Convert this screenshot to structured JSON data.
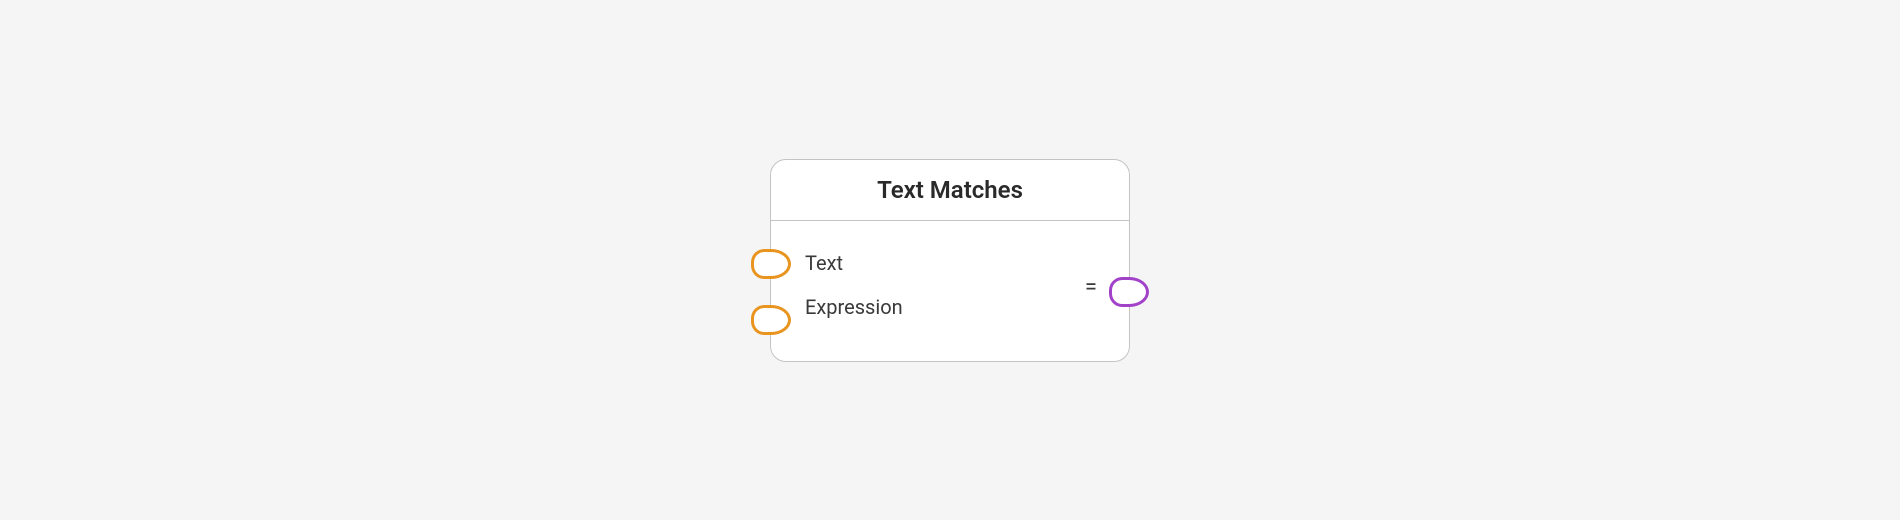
{
  "node": {
    "title": "Text Matches",
    "inputs": [
      {
        "label": "Text",
        "color": "#e8941f"
      },
      {
        "label": "Expression",
        "color": "#e8941f"
      }
    ],
    "output": {
      "label": "=",
      "color": "#a142c9"
    }
  }
}
